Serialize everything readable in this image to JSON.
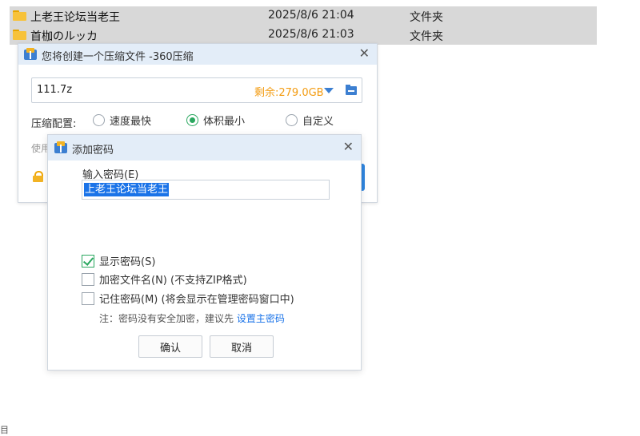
{
  "file_list": [
    {
      "name": "上老王论坛当老王",
      "date": "2025/8/6 21:04",
      "type": "文件夹",
      "icon": "folder-icon"
    },
    {
      "name": "首枷のルッカ",
      "date": "2025/8/6 21:03",
      "type": "文件夹",
      "icon": "folder-icon"
    }
  ],
  "zip_window": {
    "title": "您将创建一个压缩文件 -360压缩",
    "close": "✕",
    "path_value": "111.7z",
    "free_space": "剩余:279.0GB",
    "config_label": "压缩配置:",
    "options": [
      "速度最快",
      "体积最小",
      "自定义"
    ],
    "selected_option": "体积最小",
    "use_text": "使用"
  },
  "password_dialog": {
    "title": "添加密码",
    "close": "✕",
    "input_label": "输入密码(E)",
    "input_value": "上老王论坛当老王",
    "show_password": "显示密码(S)",
    "show_password_checked": true,
    "encrypt_names": "加密文件名(N) (不支持ZIP格式)",
    "encrypt_names_checked": false,
    "remember": "记住密码(M) (将会显示在管理密码窗口中)",
    "remember_checked": false,
    "note": "注：密码没有安全加密，建议先 ",
    "note_link": "设置主密码",
    "ok": "确认",
    "cancel": "取消"
  },
  "corner_text": "目",
  "colors": {
    "accent": "#1a73e8",
    "check": "#2aa75f",
    "warn": "#f39c12",
    "title_bar": "#e3edf8"
  }
}
